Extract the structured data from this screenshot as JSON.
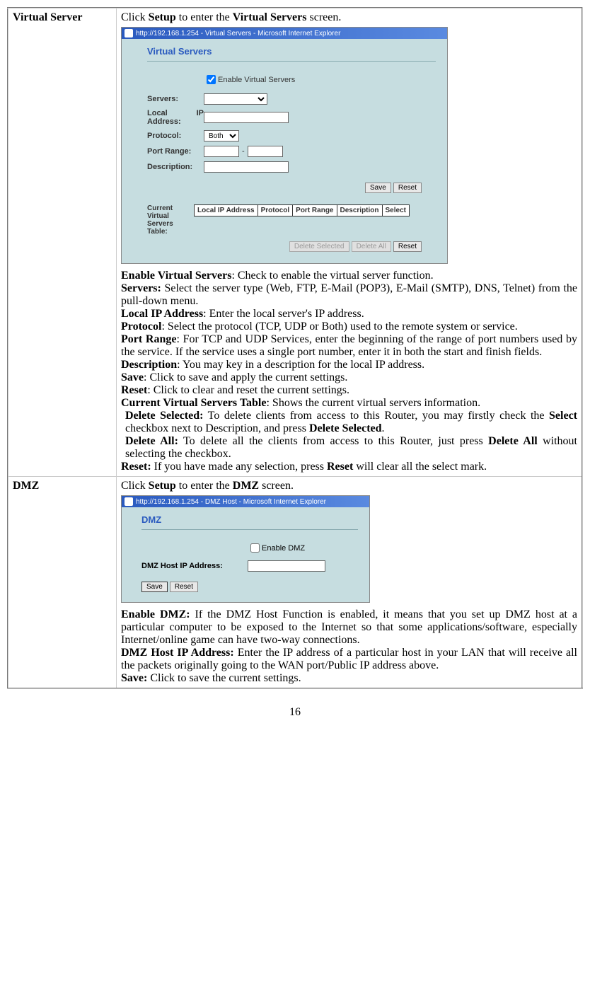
{
  "rows": {
    "virtualServer": {
      "label": "Virtual Server",
      "intro_pre": "Click ",
      "intro_bold1": "Setup",
      "intro_mid": " to enter the ",
      "intro_bold2": "Virtual Servers",
      "intro_post": " screen."
    },
    "dmz": {
      "label": "DMZ",
      "intro_pre": "Click ",
      "intro_bold1": "Setup",
      "intro_mid": " to enter the ",
      "intro_bold2": "DMZ",
      "intro_post": " screen."
    }
  },
  "vs_screenshot": {
    "titlebar": "http://192.168.1.254 - Virtual Servers - Microsoft Internet Explorer",
    "title": "Virtual Servers",
    "enable_label": "Enable Virtual Servers",
    "fields": {
      "servers": "Servers:",
      "localip": "Local IP Address:",
      "protocol": "Protocol:",
      "protocol_value": "Both",
      "portrange": "Port Range:",
      "dash": "-",
      "description": "Description:"
    },
    "buttons": {
      "save": "Save",
      "reset": "Reset",
      "delete_selected": "Delete Selected",
      "delete_all": "Delete All"
    },
    "table_label": "Current Virtual Servers Table:",
    "table_headers": [
      "Local IP Address",
      "Protocol",
      "Port Range",
      "Description",
      "Select"
    ]
  },
  "dmz_screenshot": {
    "titlebar": "http://192.168.1.254 - DMZ Host - Microsoft Internet Explorer",
    "title": "DMZ",
    "enable_label": "Enable DMZ",
    "host_label": "DMZ Host IP Address:",
    "buttons": {
      "save": "Save",
      "reset": "Reset"
    }
  },
  "vs_desc": {
    "enable_b": "Enable Virtual Servers",
    "enable_t": ": Check to enable the virtual server function.",
    "servers_b": "Servers:",
    "servers_t": " Select the server type (Web, FTP, E-Mail (POP3), E-Mail (SMTP), DNS, Telnet) from the pull-down menu.",
    "localip_b": "Local IP Address",
    "localip_t": ": Enter the local server's IP address.",
    "protocol_b": "Protocol",
    "protocol_t": ": Select the protocol (TCP, UDP or Both) used to the remote system or service.",
    "portrange_b": "Port Range",
    "portrange_t": ": For TCP and UDP Services, enter the beginning of the range of port numbers used by the service. If the service uses a single port number, enter it in both the start and finish fields.",
    "description_b": "Description",
    "description_t": ": You may key in a description for the local IP address.",
    "save_b": "Save",
    "save_t": ": Click to save and apply the current settings.",
    "reset_b": "Reset",
    "reset_t": ": Click to clear and reset the current settings.",
    "cvst_b": "Current Virtual Servers Table",
    "cvst_t": ": Shows the current virtual servers information.",
    "ds_b": "Delete Selected:",
    "ds_t1": " To delete clients from access to this Router, you may firstly check the ",
    "ds_b2": "Select",
    "ds_t2": " checkbox next to Description, and press ",
    "ds_b3": "Delete Selected",
    "ds_t3": ".",
    "da_b": "Delete All:",
    "da_t1": " To delete all the clients from access to this Router, just press ",
    "da_b2": "Delete All",
    "da_t2": " without selecting the checkbox.",
    "r2_b": "Reset:",
    "r2_t1": " If you have made any selection, press ",
    "r2_b2": "Reset",
    "r2_t2": " will clear all the select mark."
  },
  "dmz_desc": {
    "enable_b": "Enable DMZ:",
    "enable_t": " If the DMZ Host Function is enabled, it means that you set up DMZ host at a particular computer to be exposed to the Internet so that some applications/software, especially Internet/online game can have two-way connections.",
    "host_b": "DMZ Host IP Address:",
    "host_t": " Enter the IP address of a particular host in your LAN that will receive all the packets originally going to the WAN port/Public IP address above.",
    "save_b": "Save:",
    "save_t": " Click to save the current settings."
  },
  "page_number": "16"
}
